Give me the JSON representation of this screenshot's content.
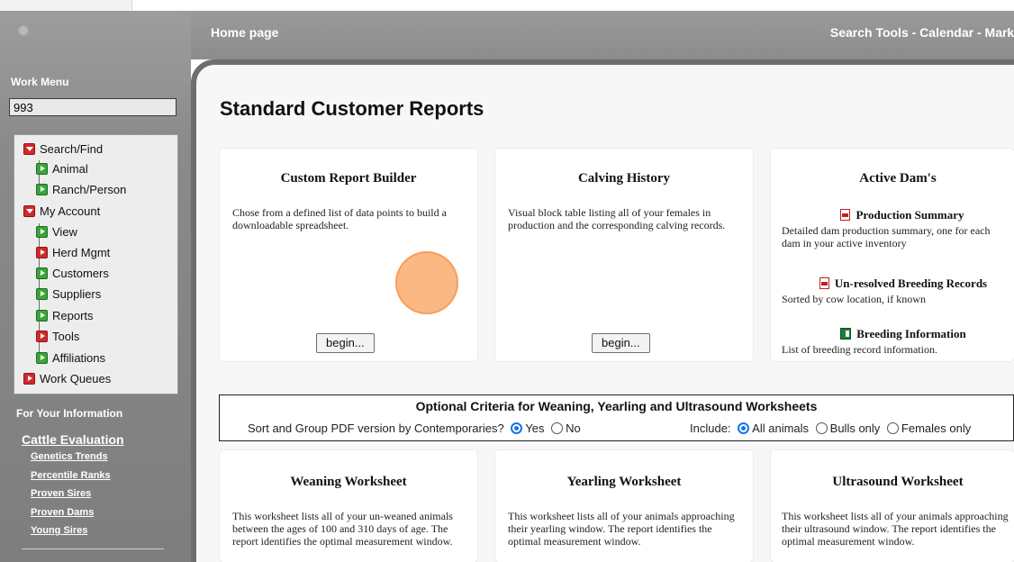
{
  "header": {
    "title": "Home page",
    "nav": "Search Tools - Calendar - Marke"
  },
  "sidebar": {
    "work_menu_title": "Work Menu",
    "search_value": "993",
    "menu": [
      {
        "label": "Search/Find",
        "icon": "red-expanded"
      },
      {
        "label": "Animal",
        "icon": "green"
      },
      {
        "label": "Ranch/Person",
        "icon": "green"
      },
      {
        "label": "My Account",
        "icon": "red-expanded"
      },
      {
        "label": "View",
        "icon": "green"
      },
      {
        "label": "Herd Mgmt",
        "icon": "red-collapsed"
      },
      {
        "label": "Customers",
        "icon": "green"
      },
      {
        "label": "Suppliers",
        "icon": "green"
      },
      {
        "label": "Reports",
        "icon": "green"
      },
      {
        "label": "Tools",
        "icon": "red-collapsed"
      },
      {
        "label": "Affiliations",
        "icon": "green"
      },
      {
        "label": "Work Queues",
        "icon": "red-collapsed"
      }
    ],
    "fyi_title": "For Your Information",
    "cattle_evaluation": {
      "title": "Cattle Evaluation",
      "links": [
        "Genetics Trends",
        "Percentile Ranks",
        "Proven Sires",
        "Proven Dams",
        "Young Sires"
      ]
    }
  },
  "main": {
    "page_title": "Standard Customer Reports",
    "cards_top": [
      {
        "title": "Custom Report Builder",
        "description": "Chose from a defined list of data points to build a downloadable spreadsheet.",
        "button": "begin..."
      },
      {
        "title": "Calving History",
        "description": "Visual block table listing all of your females in production and the corresponding calving records.",
        "button": "begin..."
      }
    ],
    "active_dams": {
      "title": "Active Dam's",
      "reports": [
        {
          "title": "Production Summary",
          "icon": "pdf-icon",
          "description": "Detailed dam production summary, one for each dam in your active inventory"
        },
        {
          "title": "Un-resolved Breeding Records",
          "icon": "pdf-icon",
          "description": "Sorted by cow location, if known"
        },
        {
          "title": "Breeding Information",
          "icon": "spreadsheet-icon",
          "description": "List of breeding record information."
        }
      ]
    },
    "criteria": {
      "title": "Optional Criteria for Weaning, Yearling and Ultrasound Worksheets",
      "sort_label": "Sort and Group PDF version by Contemporaries?",
      "sort_options": [
        "Yes",
        "No"
      ],
      "sort_selected": "Yes",
      "include_label": "Include:",
      "include_options": [
        "All animals",
        "Bulls only",
        "Females only"
      ],
      "include_selected": "All animals"
    },
    "worksheets": [
      {
        "title": "Weaning Worksheet",
        "description": "This worksheet lists all of your un-weaned animals between the ages of 100 and 310 days of age. The report identifies the optimal measurement window."
      },
      {
        "title": "Yearling Worksheet",
        "description": "This worksheet lists all of your animals approaching their yearling window. The report identifies the optimal measurement window."
      },
      {
        "title": "Ultrasound Worksheet",
        "description": "This worksheet lists all of your animals approaching their ultrasound window. The report identifies the optimal measurement window."
      }
    ]
  },
  "colors": {
    "sidebar_bg": "#8a8a8a",
    "header_bg": "#959595",
    "content_bg": "#f7f7f7",
    "radio_accent": "#1a73e8",
    "icon_red": "#d02a2a",
    "icon_green": "#3aa53a"
  }
}
